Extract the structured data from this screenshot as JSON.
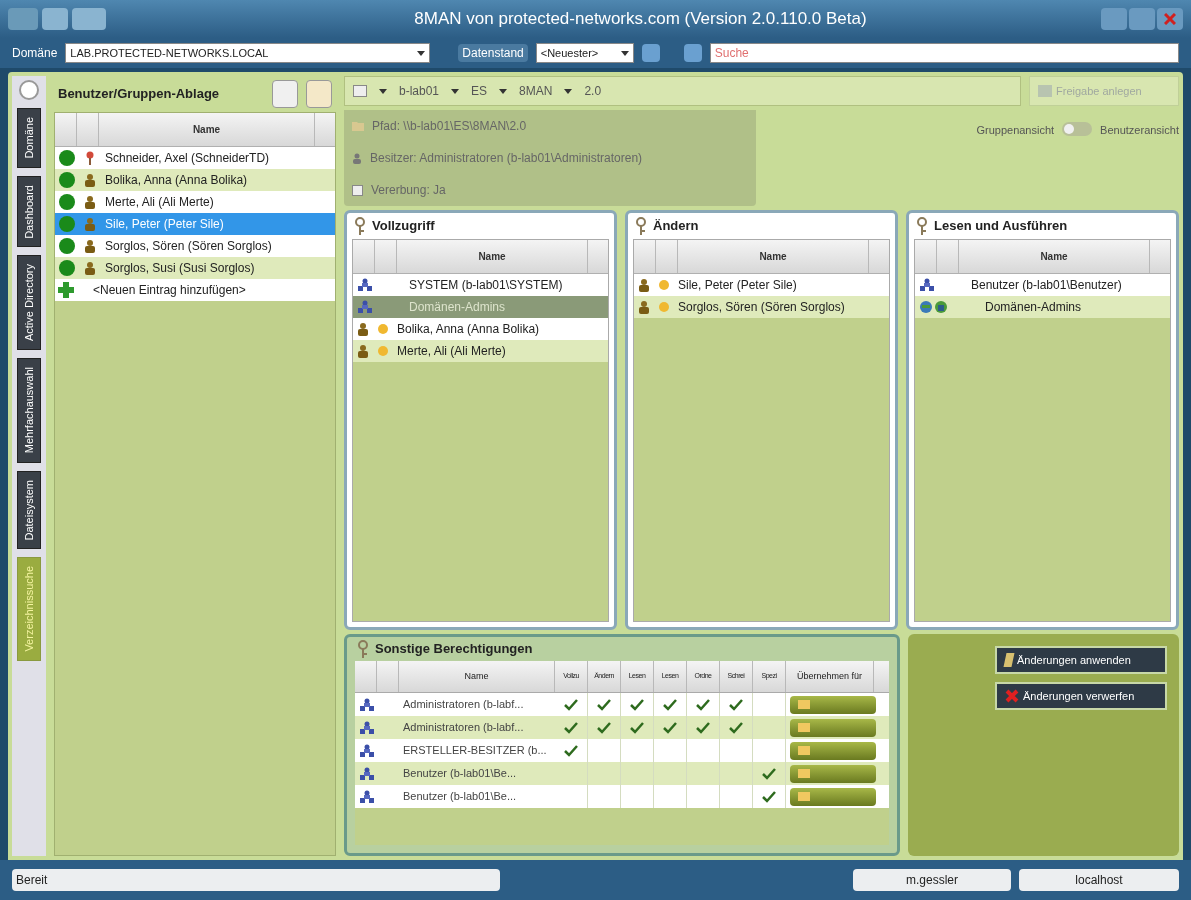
{
  "window": {
    "title": "8MAN von protected-networks.com (Version 2.0.110.0 Beta)"
  },
  "toolbar": {
    "domain_label": "Domäne",
    "domain_value": "LAB.PROTECTED-NETWORKS.LOCAL",
    "datastate_label": "Datenstand",
    "datastate_value": "<Neuester>",
    "search": {
      "placeholder": "Suche"
    }
  },
  "side_tabs": [
    {
      "label": "Domäne",
      "selected": false
    },
    {
      "label": "Dashboard",
      "selected": false
    },
    {
      "label": "Active Directory",
      "selected": false
    },
    {
      "label": "Mehrfachauswahl",
      "selected": false
    },
    {
      "label": "Dateisystem",
      "selected": false
    },
    {
      "label": "Verzeichnissuche",
      "selected": true
    }
  ],
  "storage": {
    "title": "Benutzer/Gruppen-Ablage",
    "column": "Name",
    "rows": [
      {
        "name": "Schneider, Axel (SchneiderTD)",
        "kind": "pin",
        "selected": false
      },
      {
        "name": "Bolika, Anna (Anna Bolika)",
        "kind": "user",
        "selected": false
      },
      {
        "name": "Merte, Ali (Ali Merte)",
        "kind": "user",
        "selected": false
      },
      {
        "name": "Sile, Peter (Peter Sile)",
        "kind": "user",
        "selected": true
      },
      {
        "name": "Sorglos, Sören (Sören Sorglos)",
        "kind": "user",
        "selected": false
      },
      {
        "name": "Sorglos, Susi (Susi Sorglos)",
        "kind": "user",
        "selected": false
      },
      {
        "name": "<Neuen Eintrag hinzufügen>",
        "kind": "add",
        "selected": false
      }
    ]
  },
  "breadcrumb": [
    "b-lab01",
    "ES",
    "8MAN",
    "2.0"
  ],
  "share_button": {
    "label": "Freigabe anlegen",
    "disabled": true
  },
  "info": [
    {
      "kind": "path",
      "text": "Pfad: \\\\b-lab01\\ES\\8MAN\\2.0"
    },
    {
      "kind": "owner",
      "text": "Besitzer: Administratoren (b-lab01\\Administratoren)"
    },
    {
      "kind": "inherit",
      "text": "Vererbung: Ja"
    }
  ],
  "view_toggle": {
    "left": "Gruppenansicht",
    "right": "Benutzeransicht",
    "on": false
  },
  "panels": [
    {
      "title": "Vollzugriff",
      "column": "Name",
      "rows": [
        {
          "name": "SYSTEM (b-lab01\\SYSTEM)",
          "kind": "group",
          "selected": false
        },
        {
          "name": "Domänen-Admins",
          "kind": "group",
          "selected": true
        },
        {
          "name": "Bolika, Anna (Anna Bolika)",
          "kind": "user",
          "selected": false
        },
        {
          "name": "Merte, Ali (Ali Merte)",
          "kind": "user",
          "selected": false
        }
      ]
    },
    {
      "title": "Ändern",
      "column": "Name",
      "rows": [
        {
          "name": "Sile, Peter (Peter Sile)",
          "kind": "user",
          "selected": false
        },
        {
          "name": "Sorglos, Sören (Sören Sorglos)",
          "kind": "user",
          "selected": false
        }
      ]
    },
    {
      "title": "Lesen und Ausführen",
      "column": "Name",
      "rows": [
        {
          "name": "Benutzer (b-lab01\\Benutzer)",
          "kind": "group",
          "selected": false
        },
        {
          "name": "Domänen-Admins",
          "kind": "domain",
          "selected": false
        }
      ]
    }
  ],
  "other": {
    "title": "Sonstige Berechtigungen",
    "columns": [
      "Name",
      "Vollzu",
      "Ändern",
      "Lesen",
      "Lesen",
      "Ordne",
      "Schrei",
      "Spezi",
      "Übernehmen für"
    ],
    "rows": [
      {
        "name": "Administratoren (b-labf...",
        "checks": [
          true,
          true,
          true,
          true,
          true,
          true,
          false
        ]
      },
      {
        "name": "Administratoren (b-labf...",
        "checks": [
          true,
          true,
          true,
          true,
          true,
          true,
          false
        ]
      },
      {
        "name": "ERSTELLER-BESITZER (b...",
        "checks": [
          true,
          false,
          false,
          false,
          false,
          false,
          false
        ]
      },
      {
        "name": "Benutzer (b-lab01\\Be...",
        "checks": [
          false,
          false,
          false,
          false,
          false,
          false,
          true
        ]
      },
      {
        "name": "Benutzer (b-lab01\\Be...",
        "checks": [
          false,
          false,
          false,
          false,
          false,
          false,
          true
        ]
      }
    ]
  },
  "actions": [
    {
      "kind": "apply",
      "label": "Änderungen anwenden"
    },
    {
      "kind": "discard",
      "label": "Änderungen verwerfen"
    }
  ],
  "status_bar": {
    "status": "Bereit",
    "user": "m.gessler",
    "host": "localhost"
  }
}
